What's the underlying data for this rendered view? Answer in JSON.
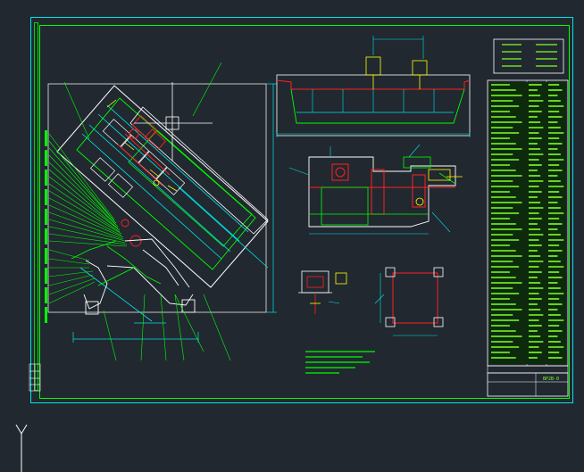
{
  "drawing": {
    "number": "BP2B-0",
    "colors": {
      "background": "#212830",
      "border": "#00ff00",
      "dimension": "#00e5e5",
      "outline": "#ffffff",
      "hidden": "#ff2020",
      "accent": "#ffff00",
      "table_text": "#7dff2a"
    },
    "icons": [
      "ucs-y-axis-icon",
      "crosshair-cursor-icon"
    ]
  }
}
